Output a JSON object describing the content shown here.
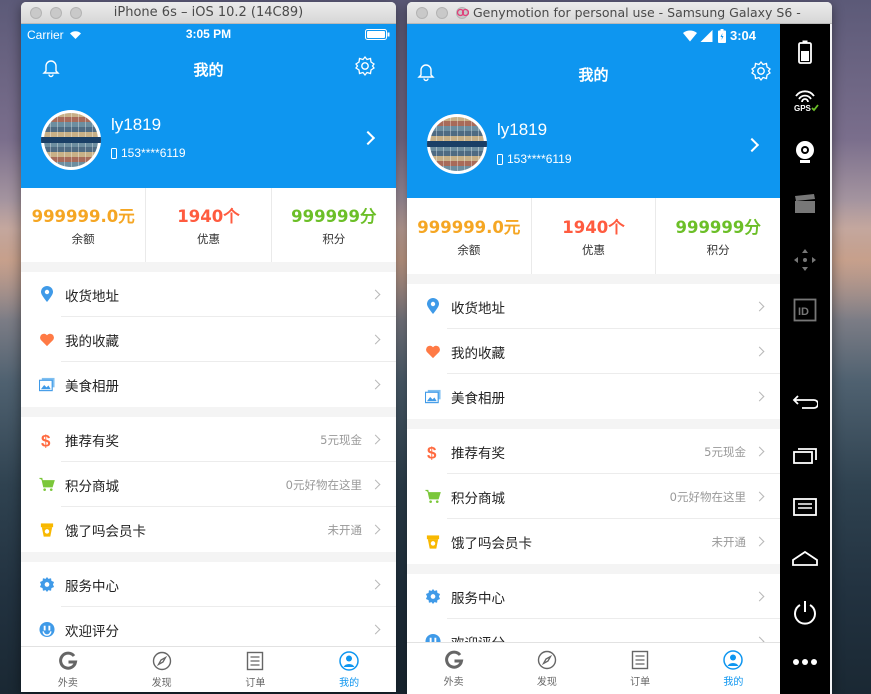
{
  "ios": {
    "window_title": "iPhone 6s – iOS 10.2 (14C89)",
    "status": {
      "carrier": "Carrier",
      "time": "3:05 PM"
    }
  },
  "android": {
    "window_title": "Genymotion for personal use - Samsung Galaxy S6 -",
    "status": {
      "time": "3:04"
    }
  },
  "app": {
    "nav_title": "我的",
    "profile": {
      "username": "ly1819",
      "phone": "153****6119"
    },
    "stats": [
      {
        "value": "999999.0元",
        "label": "余额",
        "color": "#f5a623"
      },
      {
        "value": "1940个",
        "label": "优惠",
        "color": "#ff5b3f"
      },
      {
        "value": "999999分",
        "label": "积分",
        "color": "#6cbf28"
      }
    ],
    "groups": [
      [
        {
          "icon": "location-pin-icon",
          "label": "收货地址",
          "aux": ""
        },
        {
          "icon": "heart-icon",
          "label": "我的收藏",
          "aux": ""
        },
        {
          "icon": "photo-album-icon",
          "label": "美食相册",
          "aux": ""
        }
      ],
      [
        {
          "icon": "dollar-icon",
          "label": "推荐有奖",
          "aux": "5元现金"
        },
        {
          "icon": "cart-icon",
          "label": "积分商城",
          "aux": "0元好物在这里"
        },
        {
          "icon": "vip-card-icon",
          "label": "饿了吗会员卡",
          "aux": "未开通"
        }
      ],
      [
        {
          "icon": "service-gear-icon",
          "label": "服务中心",
          "aux": ""
        },
        {
          "icon": "rating-icon",
          "label": "欢迎评分",
          "aux": ""
        }
      ]
    ],
    "tabs": [
      {
        "label": "外卖",
        "icon": "takeout-g-icon",
        "active": false
      },
      {
        "label": "发现",
        "icon": "compass-icon",
        "active": false
      },
      {
        "label": "订单",
        "icon": "order-list-icon",
        "active": false
      },
      {
        "label": "我的",
        "icon": "profile-icon",
        "active": true
      }
    ],
    "colors": {
      "accent": "#0e96f0"
    }
  },
  "emulator_sidebar": {
    "icons": [
      "battery-icon",
      "gps-icon",
      "camera-icon",
      "media-icon",
      "dpad-icon",
      "id-icon",
      "back-icon",
      "recent-apps-icon",
      "menu-icon",
      "home-icon",
      "power-icon",
      "more-icon"
    ],
    "gps_label": "GPS",
    "id_label": "ID"
  }
}
